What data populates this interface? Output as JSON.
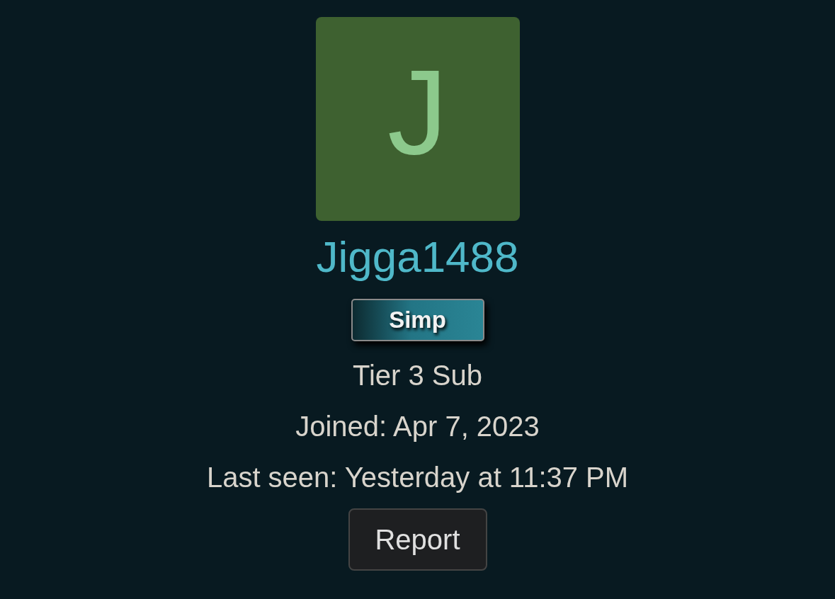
{
  "profile": {
    "avatar_letter": "J",
    "username": "Jigga1488",
    "badge": "Simp",
    "rank": "Tier 3 Sub",
    "joined": "Joined: Apr 7, 2023",
    "last_seen": "Last seen: Yesterday at 11:37 PM"
  },
  "buttons": [
    "Report"
  ]
}
